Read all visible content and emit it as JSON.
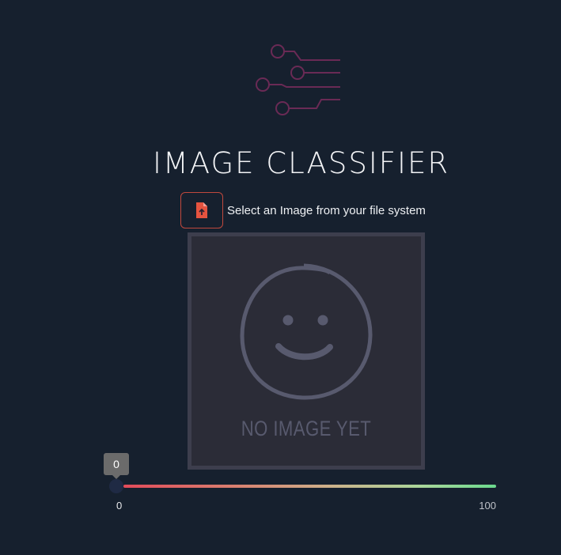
{
  "header": {
    "logo_icon": "circuit-traces-icon",
    "title": "IMAGE CLASSIFIER"
  },
  "upload": {
    "icon": "file-upload-icon",
    "label": "Select an Image from your file system"
  },
  "preview": {
    "icon": "smiley-face-icon",
    "placeholder_text": "NO IMAGE YET"
  },
  "slider": {
    "value": 0,
    "value_label": "0",
    "min_label": "0",
    "max_label": "100"
  },
  "colors": {
    "background": "#16202e",
    "accent": "#c0483d",
    "logo": "#6a2a55",
    "track_start": "#e34b5a",
    "track_end": "#6bd98e"
  }
}
